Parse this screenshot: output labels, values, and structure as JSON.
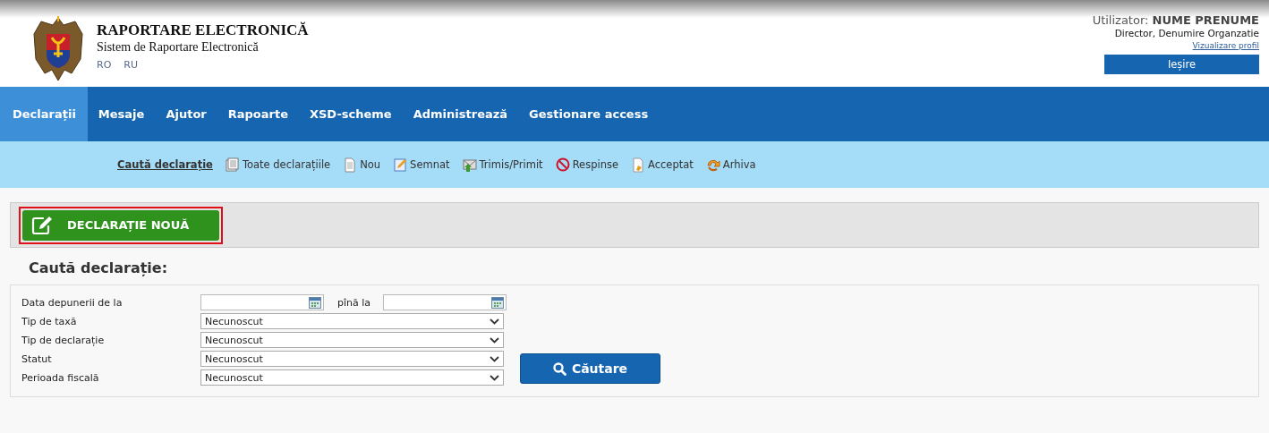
{
  "header": {
    "title": "RAPORTARE ELECTRONICĂ",
    "subtitle": "Sistem de Raportare Electronică",
    "languages": [
      {
        "label": "RO",
        "selected": false
      },
      {
        "label": "RU",
        "selected": false
      }
    ],
    "user": {
      "label": "Utilizator:",
      "name": "NUME PRENUME",
      "role": "Director, Denumire Organzatie",
      "profile_link": "Vizualizare profil",
      "logout": "Ieșire"
    }
  },
  "nav": [
    {
      "label": "Declarații",
      "selected": true
    },
    {
      "label": "Mesaje",
      "selected": false
    },
    {
      "label": "Ajutor",
      "selected": false
    },
    {
      "label": "Rapoarte",
      "selected": false
    },
    {
      "label": "XSD-scheme",
      "selected": false
    },
    {
      "label": "Administrează",
      "selected": false
    },
    {
      "label": "Gestionare access",
      "selected": false
    }
  ],
  "subnav": [
    {
      "label": "Caută declarație",
      "kind": "search",
      "selected": true
    },
    {
      "label": "Toate declarațiile",
      "kind": "stack",
      "selected": false
    },
    {
      "label": "Nou",
      "kind": "page",
      "selected": false
    },
    {
      "label": "Semnat",
      "kind": "signed",
      "selected": false
    },
    {
      "label": "Trimis/Primit",
      "kind": "sent",
      "selected": false
    },
    {
      "label": "Respinse",
      "kind": "rejected",
      "selected": false
    },
    {
      "label": "Acceptat",
      "kind": "accepted",
      "selected": false
    },
    {
      "label": "Arhiva",
      "kind": "archive",
      "selected": false
    }
  ],
  "new_button": {
    "label": "DECLARAȚIE NOUĂ",
    "highlighted": true
  },
  "search": {
    "title": "Caută declarație:",
    "fields": [
      {
        "kind": "date-range",
        "label": "Data depunerii de la",
        "to_label": "pînă la"
      },
      {
        "kind": "select",
        "label": "Tip de taxă",
        "value": "Necunoscut"
      },
      {
        "kind": "select",
        "label": "Tip de declarație",
        "value": "Necunoscut"
      },
      {
        "kind": "select",
        "label": "Statut",
        "value": "Necunoscut"
      },
      {
        "kind": "select",
        "label": "Perioada fiscală",
        "value": "Necunoscut"
      }
    ],
    "button": "Căutare"
  }
}
